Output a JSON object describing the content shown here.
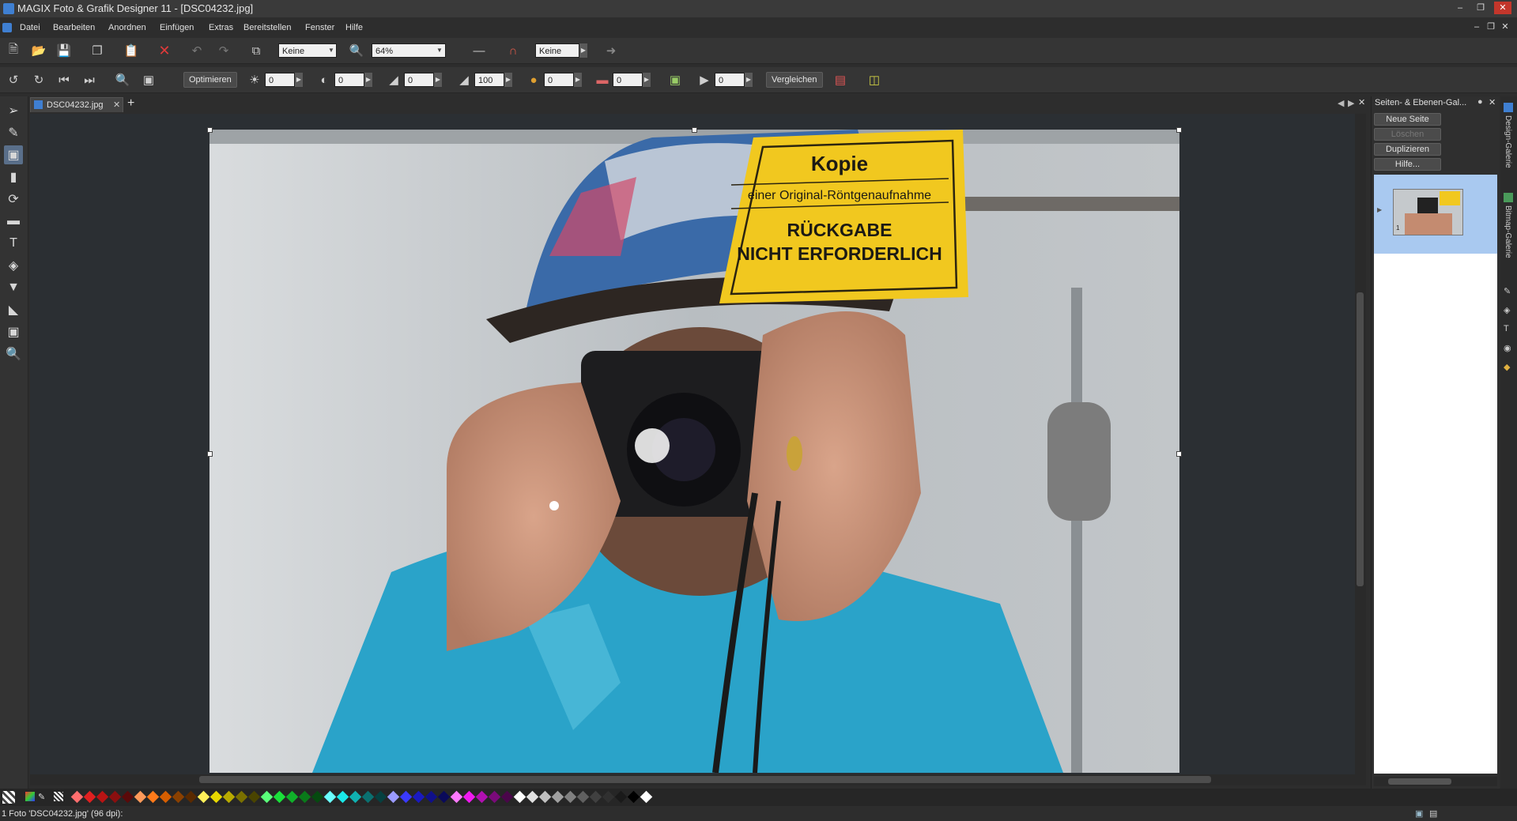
{
  "window": {
    "title": "MAGIX Foto & Grafik Designer 11 - [DSC04232.jpg]"
  },
  "menu": [
    "Datei",
    "Bearbeiten",
    "Anordnen",
    "Einfügen",
    "Extras",
    "Bereitstellen",
    "Fenster",
    "Hilfe"
  ],
  "toolbar1": {
    "fill_select": "Keine",
    "zoom": "64%",
    "feather_select": "Keine"
  },
  "toolbar2": {
    "optimize_label": "Optimieren",
    "brightness": "0",
    "contrast": "0",
    "gamma": "0",
    "saturation": "100",
    "color": "0",
    "temperature": "0",
    "sharpen": "0",
    "compare_label": "Vergleichen"
  },
  "document": {
    "tab_label": "DSC04232.jpg"
  },
  "photo": {
    "sign_title": "Kopie",
    "sign_subtitle": "einer Original-Röntgenaufnahme",
    "sign_line1": "RÜCKGABE",
    "sign_line2": "NICHT ERFORDERLICH"
  },
  "right_panel": {
    "title": "Seiten- & Ebenen-Gal...",
    "new_page": "Neue Seite",
    "delete": "Löschen",
    "duplicate": "Duplizieren",
    "help": "Hilfe...",
    "thumb_index": "1"
  },
  "side_tabs": {
    "design_gallery": "Design-Galerie",
    "bitmap_gallery": "Bitmap-Galerie"
  },
  "status": {
    "text": "1 Foto 'DSC04232.jpg' (96 dpi):"
  },
  "colors": {
    "palette": [
      "#ff6e6e",
      "#e02020",
      "#b81414",
      "#8a0f0f",
      "#5a0a0a",
      "#ff9a5a",
      "#ff7a1a",
      "#d55e00",
      "#8a4000",
      "#5a2a00",
      "#fff05a",
      "#e8d800",
      "#b8aa00",
      "#7a7000",
      "#4a4400",
      "#5aff7a",
      "#1ae03a",
      "#10b02a",
      "#0a7a1a",
      "#064a10",
      "#6affff",
      "#1ae8e8",
      "#10b0b0",
      "#0a7070",
      "#064040",
      "#9a9aff",
      "#3a3aff",
      "#1a1ac0",
      "#10108a",
      "#0a0a5a",
      "#ff7aff",
      "#f01af0",
      "#b010b0",
      "#7a0a7a",
      "#4a064a",
      "#ffffff",
      "#e0e0e0",
      "#c0c0c0",
      "#a0a0a0",
      "#808080",
      "#606060",
      "#404040",
      "#303030",
      "#1a1a1a",
      "#000000",
      "#ffffff"
    ]
  }
}
